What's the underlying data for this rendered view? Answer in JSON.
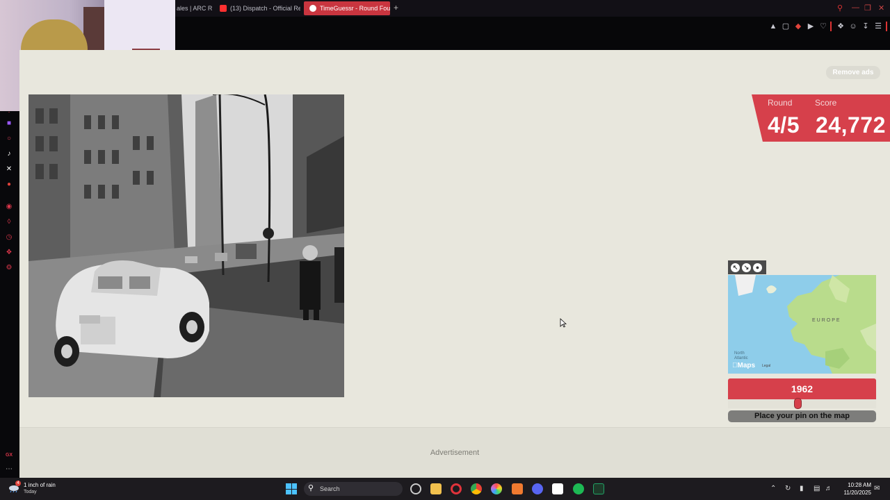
{
  "browser": {
    "tabs": [
      {
        "label": "ales | ARC R",
        "active": false,
        "favicon_color": "#e0e0e0"
      },
      {
        "label": "(13) Dispatch - Official Re",
        "active": false,
        "favicon_color": "#ff3030"
      },
      {
        "label": "TimeGuessr - Round Four",
        "active": true,
        "favicon_color": "#ffffff"
      }
    ],
    "new_tab_icon": "+",
    "accent_color": "#c9353f"
  },
  "game": {
    "remove_ads_label": "Remove ads",
    "round_label": "Round",
    "round_value": "4/5",
    "score_label": "Score",
    "score_value": "24,772",
    "map": {
      "europe_label": "EUROPE",
      "ocean_label_line1": "North",
      "ocean_label_line2": "Atlantic",
      "maps_logo": "Maps",
      "legal": "Legal"
    },
    "year": "1962",
    "year_slider_fraction": 0.47,
    "pin_prompt": "Place your pin on the map",
    "advertisement_label": "Advertisement",
    "brand_color": "#d6404b"
  },
  "taskbar": {
    "weather_text": "1 inch of rain",
    "weather_sub": "Today",
    "weather_badge": "4",
    "search_label": "Search",
    "time": "10:28 AM",
    "date": "11/20/2025"
  }
}
